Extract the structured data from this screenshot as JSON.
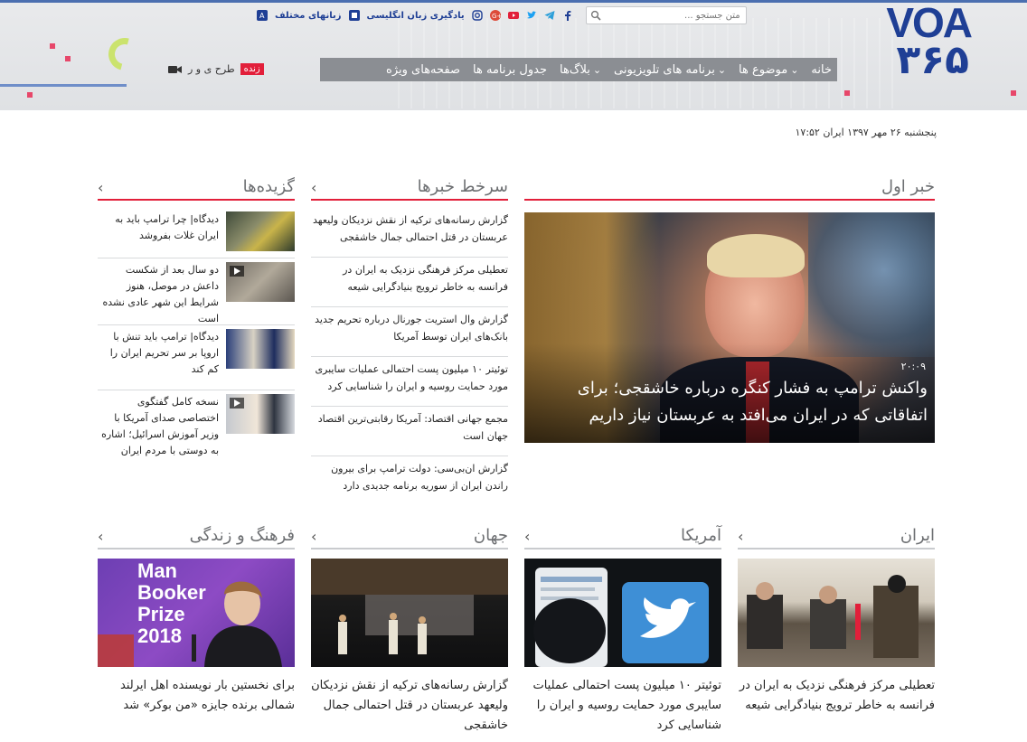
{
  "header": {
    "logo_top": "VOA",
    "logo_bottom": "۳۶۵",
    "search_placeholder": "متن جستجو ...",
    "links": {
      "learn_english": "یادگیری زبان انگلیسی",
      "languages": "زبانهای مختلف"
    },
    "social_icons": [
      "facebook-icon",
      "telegram-icon",
      "twitter-icon",
      "youtube-icon",
      "google-plus-icon",
      "instagram-icon"
    ],
    "nav": [
      {
        "label": "خانه",
        "has_dropdown": false
      },
      {
        "label": "موضوع ها",
        "has_dropdown": true
      },
      {
        "label": "برنامه های تلویزیونی",
        "has_dropdown": true
      },
      {
        "label": "بلاگ‌ها",
        "has_dropdown": true
      },
      {
        "label": "جدول برنامه ها",
        "has_dropdown": false
      },
      {
        "label": "صفحه‌های ویژه",
        "has_dropdown": false
      }
    ],
    "live_badge": "زنده",
    "live_label": "طرح ی و ر",
    "colors": {
      "brand_blue": "#1f3f95",
      "brand_red": "#e21f3a",
      "nav_gray": "#8b8e93"
    }
  },
  "date": "پنجشنبه ۲۶ مهر ۱۳۹۷ ایران ۱۷:۵۲",
  "sections": {
    "top_story": {
      "title": "خبر اول",
      "time": "۲۰:۰۹",
      "headline": "واکنش ترامپ به فشار کنگره درباره خاشقجی؛ برای اتفاقاتی که در ایران می‌افتد به عربستان نیاز داریم"
    },
    "headlines": {
      "title": "سرخط خبرها",
      "items": [
        "گزارش رسانه‌های ترکیه از نقش نزدیکان ولیعهد عربستان در قتل احتمالی جمال خاشقجی",
        "تعطیلی مرکز فرهنگی نزدیک به ایران در فرانسه به خاطر ترویج بنیادگرایی شیعه",
        "گزارش وال استریت جورنال درباره تحریم جدید بانک‌های ایران توسط آمریکا",
        "توئیتر ۱۰ میلیون پست احتمالی عملیات سایبری مورد حمایت روسیه و ایران را شناسایی کرد",
        "مجمع جهانی اقتصاد: آمریکا رقابتی‌ترین اقتصاد جهان است",
        "گزارش ان‌بی‌سی: دولت ترامپ برای بیرون راندن ایران از سوریه برنامه جدیدی دارد"
      ]
    },
    "picks": {
      "title": "گزیده‌ها",
      "items": [
        {
          "text": "دیدگاه| چرا ترامپ باید به ایران غلات بفروشد",
          "video": false
        },
        {
          "text": "دو سال بعد از شکست داعش در موصل، هنوز شرایط این شهر عادی نشده است",
          "video": true
        },
        {
          "text": "دیدگاه| ترامپ باید تنش با اروپا بر سر تحریم ایران را کم کند",
          "video": false
        },
        {
          "text": "نسخه کامل گفتگوی اختصاصی صدای آمریکا با وزیر آموزش اسرائیل؛ اشاره به دوستی با مردم ایران",
          "video": true
        }
      ]
    },
    "cards": [
      {
        "title": "ایران",
        "text": "تعطیلی مرکز فرهنگی نزدیک به ایران در فرانسه به خاطر ترویج بنیادگرایی شیعه"
      },
      {
        "title": "آمریکا",
        "text": "توئیتر ۱۰ میلیون پست احتمالی عملیات سایبری مورد حمایت روسیه و ایران را شناسایی کرد"
      },
      {
        "title": "جهان",
        "text": "گزارش رسانه‌های ترکیه از نقش نزدیکان ولیعهد عربستان در قتل احتمالی جمال خاشقجی"
      },
      {
        "title": "فرهنگ و زندگی",
        "text": "برای نخستین بار نویسنده اهل ایرلند شمالی برنده جایزه «من بوکر» شد",
        "image_text": [
          "Man",
          "Booker",
          "Prize",
          "2018"
        ]
      }
    ]
  }
}
